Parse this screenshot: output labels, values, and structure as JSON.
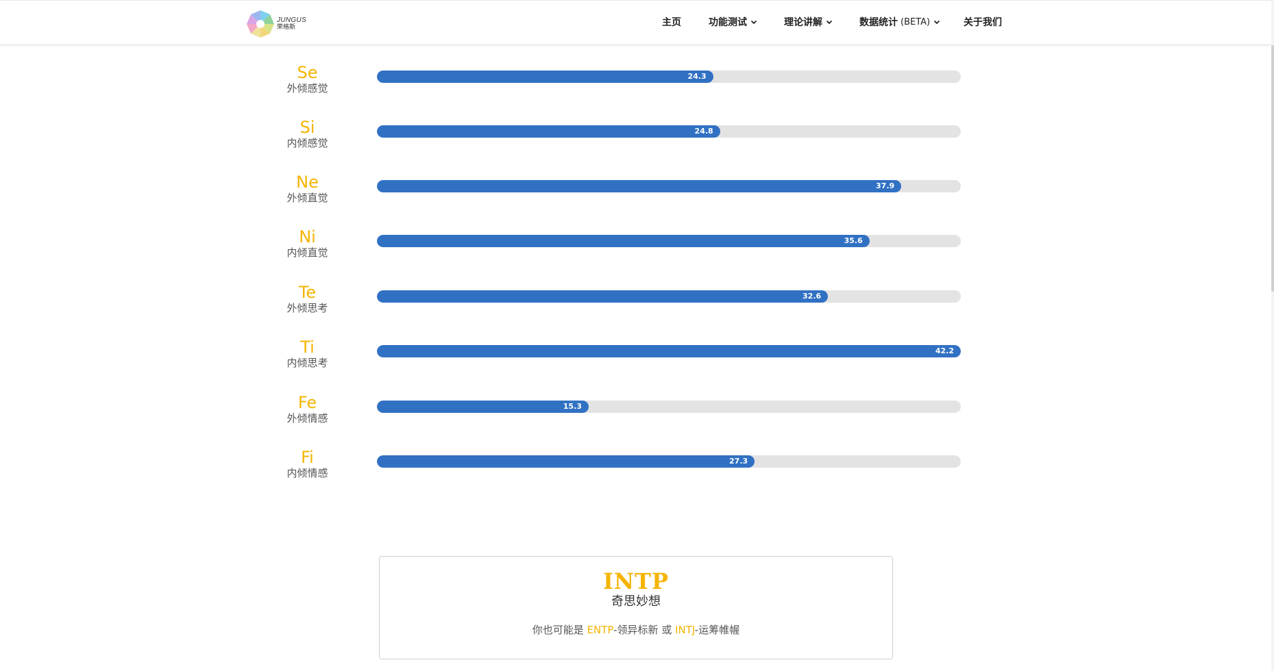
{
  "header": {
    "logo": {
      "en": "JUNGUS",
      "cn": "荣格斯"
    },
    "nav": [
      {
        "label": "主页",
        "dropdown": false
      },
      {
        "label": "功能测试",
        "dropdown": true
      },
      {
        "label": "理论讲解",
        "dropdown": true
      },
      {
        "label": "数据统计",
        "suffix": "(BETA)",
        "dropdown": true
      },
      {
        "label": "关于我们",
        "dropdown": false
      }
    ]
  },
  "functions": [
    {
      "code": "Se",
      "name": "外倾感觉",
      "value": "24.3"
    },
    {
      "code": "Si",
      "name": "内倾感觉",
      "value": "24.8"
    },
    {
      "code": "Ne",
      "name": "外倾直觉",
      "value": "37.9"
    },
    {
      "code": "Ni",
      "name": "内倾直觉",
      "value": "35.6"
    },
    {
      "code": "Te",
      "name": "外倾思考",
      "value": "32.6"
    },
    {
      "code": "Ti",
      "name": "内倾思考",
      "value": "42.2"
    },
    {
      "code": "Fe",
      "name": "外倾情感",
      "value": "15.3"
    },
    {
      "code": "Fi",
      "name": "内倾情感",
      "value": "27.3"
    }
  ],
  "scale_max": 42.2,
  "result": {
    "type": "INTP",
    "name": "奇思妙想",
    "alt_prefix": "你也可能是 ",
    "alt1_type": "ENTP",
    "alt1_name": "-领异标新",
    "alt_or": " 或 ",
    "alt2_type": "INTJ",
    "alt2_name": "-运筹帷幄"
  },
  "colors": {
    "accent": "#f5b400",
    "bar": "#3171c3",
    "track": "#e3e3e3"
  }
}
